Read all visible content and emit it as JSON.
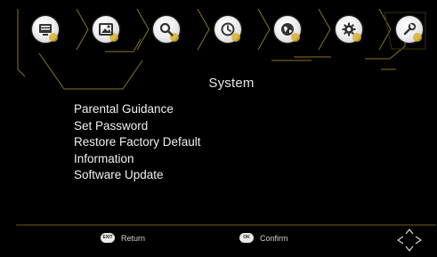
{
  "toolbar": {
    "icons": [
      {
        "name": "channel-list-icon"
      },
      {
        "name": "picture-icon"
      },
      {
        "name": "search-icon"
      },
      {
        "name": "timer-icon"
      },
      {
        "name": "globe-icon"
      },
      {
        "name": "gear-icon"
      },
      {
        "name": "system-tools-icon",
        "selected": true
      }
    ]
  },
  "page": {
    "title": "System"
  },
  "menu": {
    "items": [
      {
        "label": "Parental Guidance"
      },
      {
        "label": "Set Password"
      },
      {
        "label": "Restore Factory Default"
      },
      {
        "label": "Information"
      },
      {
        "label": "Software Update"
      }
    ]
  },
  "footer": {
    "return": {
      "key": "EXIT",
      "label": "Return"
    },
    "confirm": {
      "key": "OK",
      "label": "Confirm"
    },
    "nav_icon": "direction-arrows-icon"
  },
  "colors": {
    "background": "#000000",
    "accent": "#d8b22a",
    "text": "#e8e8e8",
    "line": "#7d6a22"
  }
}
